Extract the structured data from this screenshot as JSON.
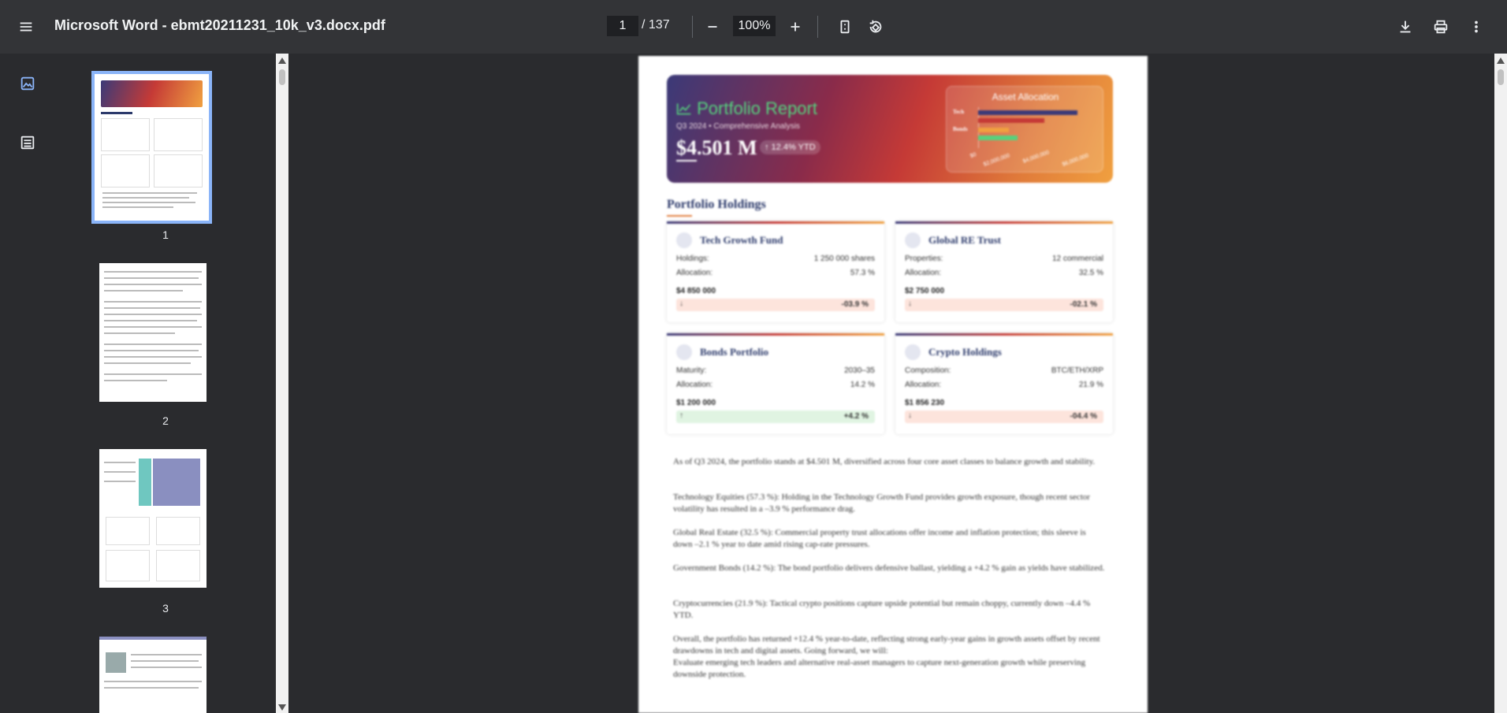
{
  "toolbar": {
    "title": "Microsoft Word - ebmt20211231_10k_v3.docx.pdf",
    "page_current": "1",
    "page_total": "/ 137",
    "zoom": "100%",
    "icons": [
      "menu-icon",
      "minus-icon",
      "plus-icon",
      "fit-page-icon",
      "rotate-icon",
      "download-icon",
      "print-icon",
      "more-vert-icon"
    ]
  },
  "sidebar": {
    "icons": [
      "thumbnails-icon",
      "outline-icon"
    ],
    "thumbnails": [
      {
        "label": "1"
      },
      {
        "label": "2"
      },
      {
        "label": "3"
      }
    ]
  },
  "document": {
    "hero": {
      "title": "Portfolio Report",
      "subtitle": "Q3 2024 • Comprehensive Analysis",
      "value": "$4.501 M",
      "badge": "↑ 12.4% YTD",
      "allocation_title": "Asset Allocation",
      "allocation_labels": [
        "Tech",
        "Bonds"
      ],
      "allocation_axis": [
        "$0",
        "$2,000,000",
        "$4,000,000",
        "$6,000,000"
      ],
      "allocation_colors": [
        "#3b3a78",
        "#c53a36",
        "#f0a040",
        "#56d27d"
      ],
      "allocation_fractions": [
        0.9,
        0.6,
        0.28,
        0.36
      ]
    },
    "section_title": "Portfolio Holdings",
    "cards": [
      {
        "title": "Tech Growth Fund",
        "r1_label": "Holdings:",
        "r1_value": "1 250 000 shares",
        "r2_label": "Allocation:",
        "r2_value": "57.3 %",
        "amount": "$4 850 000",
        "arrow": "↓",
        "perf": "-03.9 %",
        "trend": "neg"
      },
      {
        "title": "Global RE Trust",
        "r1_label": "Properties:",
        "r1_value": "12 commercial",
        "r2_label": "Allocation:",
        "r2_value": "32.5 %",
        "amount": "$2 750 000",
        "arrow": "↓",
        "perf": "-02.1 %",
        "trend": "neg"
      },
      {
        "title": "Bonds Portfolio",
        "r1_label": "Maturity:",
        "r1_value": "2030–35",
        "r2_label": "Allocation:",
        "r2_value": "14.2 %",
        "amount": "$1 200 000",
        "arrow": "↑",
        "perf": "+4.2 %",
        "trend": "pos"
      },
      {
        "title": "Crypto Holdings",
        "r1_label": "Composition:",
        "r1_value": "BTC/ETH/XRP",
        "r2_label": "Allocation:",
        "r2_value": "21.9 %",
        "amount": "$1 856 230",
        "arrow": "↓",
        "perf": "-04.4 %",
        "trend": "neg"
      }
    ],
    "paragraphs": [
      "As of Q3 2024, the portfolio stands at $4.501 M, diversified across four core asset classes to balance growth and stability.",
      "Technology Equities (57.3 %): Holding in the Technology Growth Fund provides growth exposure, though recent sector volatility has resulted in a –3.9 % performance drag.",
      "Global Real Estate (32.5 %): Commercial property trust allocations offer income and inflation protection; this sleeve is down –2.1 % year to date amid rising cap-rate pressures.",
      "Government Bonds (14.2 %): The bond portfolio delivers defensive ballast, yielding a +4.2 % gain as yields have stabilized.",
      "Cryptocurrencies (21.9 %): Tactical crypto positions capture upside potential but remain choppy, currently down –4.4 % YTD.",
      "Overall, the portfolio has returned +12.4 % year-to-date, reflecting strong early-year gains in growth assets offset by recent drawdowns in tech and digital assets. Going forward, we will:",
      "Evaluate emerging tech leaders and alternative real-asset managers to capture next-generation growth while preserving downside protection."
    ]
  }
}
